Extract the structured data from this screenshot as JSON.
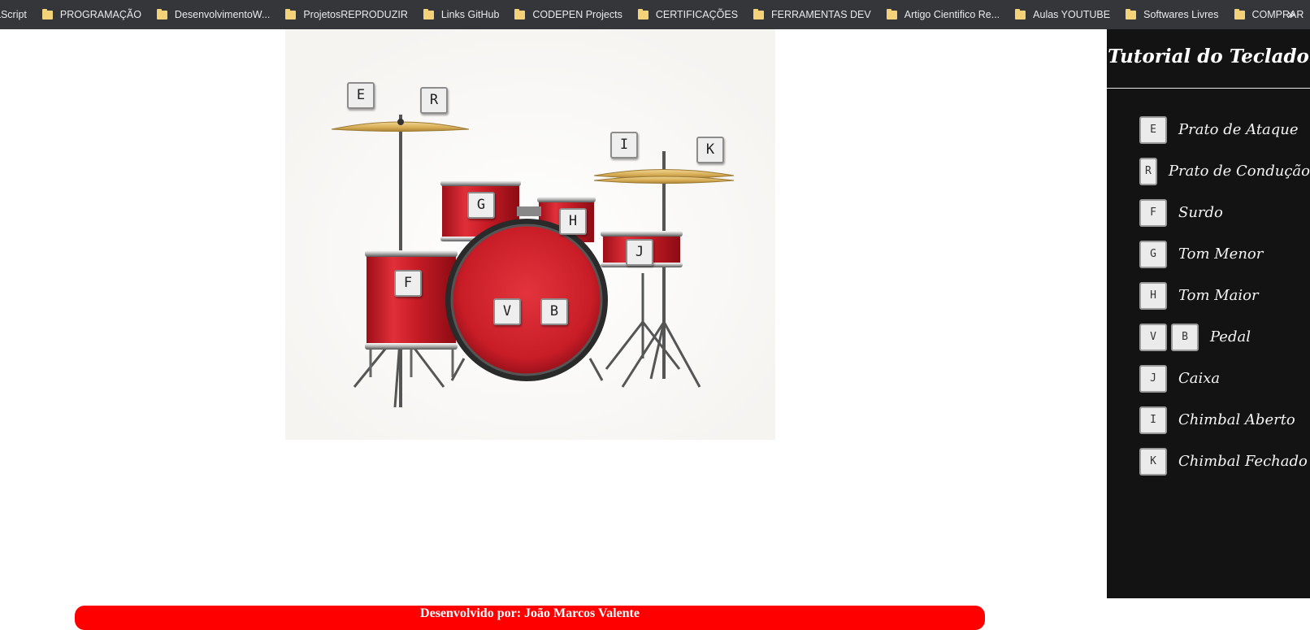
{
  "bookmarks": {
    "items": [
      {
        "label": "aScript",
        "icon": "folder-icon"
      },
      {
        "label": "PROGRAMAÇÃO",
        "icon": "folder-icon"
      },
      {
        "label": "DesenvolvimentoW...",
        "icon": "folder-icon"
      },
      {
        "label": "ProjetosREPRODUZIR",
        "icon": "folder-icon"
      },
      {
        "label": "Links GitHub",
        "icon": "folder-icon"
      },
      {
        "label": "CODEPEN Projects",
        "icon": "folder-icon"
      },
      {
        "label": "CERTIFICAÇÕES",
        "icon": "folder-icon"
      },
      {
        "label": "FERRAMENTAS DEV",
        "icon": "folder-icon"
      },
      {
        "label": "Artigo Cientifico Re...",
        "icon": "folder-icon"
      },
      {
        "label": "Aulas YOUTUBE",
        "icon": "folder-icon"
      },
      {
        "label": "Softwares Livres",
        "icon": "folder-icon"
      },
      {
        "label": "COMPRAR",
        "icon": "folder-icon"
      }
    ],
    "more": "»"
  },
  "drum": {
    "keys": {
      "E": "E",
      "R": "R",
      "I": "I",
      "K": "K",
      "G": "G",
      "H": "H",
      "F": "F",
      "J": "J",
      "V": "V",
      "B": "B"
    }
  },
  "sidebar": {
    "title": "Tutorial do Teclado",
    "items": [
      {
        "keys": [
          "E"
        ],
        "label": "Prato de Ataque"
      },
      {
        "keys": [
          "R"
        ],
        "label": "Prato de Condução"
      },
      {
        "keys": [
          "F"
        ],
        "label": "Surdo"
      },
      {
        "keys": [
          "G"
        ],
        "label": "Tom Menor"
      },
      {
        "keys": [
          "H"
        ],
        "label": "Tom Maior"
      },
      {
        "keys": [
          "V",
          "B"
        ],
        "label": "Pedal"
      },
      {
        "keys": [
          "J"
        ],
        "label": "Caixa"
      },
      {
        "keys": [
          "I"
        ],
        "label": "Chimbal Aberto"
      },
      {
        "keys": [
          "K"
        ],
        "label": "Chimbal Fechado"
      }
    ]
  },
  "footer": {
    "text": "Desenvolvido por: João Marcos Valente"
  },
  "colors": {
    "drum_red": "#d41e2a",
    "sidebar_bg": "#131313",
    "footer_bg": "#ff0000",
    "cymbal_gold": "#d9b45c"
  }
}
